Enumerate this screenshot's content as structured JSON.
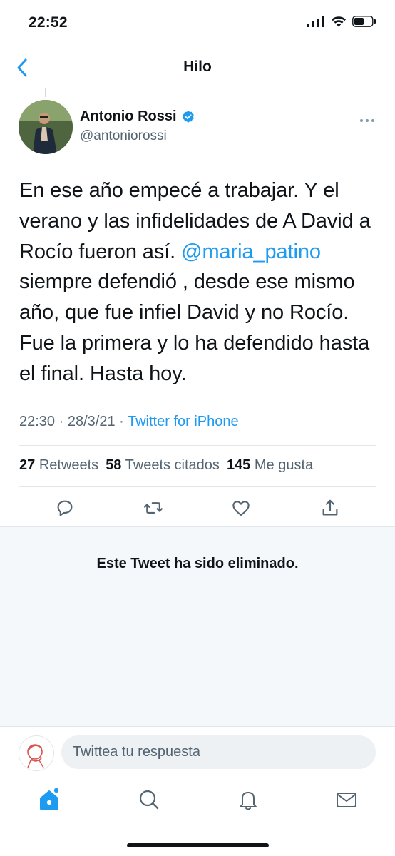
{
  "status_bar": {
    "time": "22:52"
  },
  "nav": {
    "title": "Hilo"
  },
  "tweet": {
    "author_name": "Antonio Rossi",
    "author_handle": "@antoniorossi",
    "text_before": "En ese año empecé a trabajar. Y el verano y las infidelidades de A David a Rocío fueron así. ",
    "mention": "@maria_patino",
    "text_after": " siempre defendió , desde ese mismo año, que fue infiel David y no Rocío. Fue la primera y lo ha defendido hasta el final. Hasta hoy.",
    "time": "22:30",
    "date": "28/3/21",
    "source": "Twitter for iPhone",
    "retweets_count": "27",
    "retweets_label": "Retweets",
    "quotes_count": "58",
    "quotes_label": "Tweets citados",
    "likes_count": "145",
    "likes_label": "Me gusta"
  },
  "deleted_notice": "Este Tweet ha sido eliminado.",
  "reply": {
    "placeholder": "Twittea tu respuesta"
  },
  "colors": {
    "accent": "#1d9bf0",
    "text": "#0f1419",
    "secondary": "#536471"
  },
  "icons": {
    "nav": "back-chevron-icon",
    "actions": [
      "reply-icon",
      "retweet-icon",
      "like-icon",
      "share-icon"
    ],
    "tabs": [
      "home-icon",
      "search-icon",
      "notifications-icon",
      "messages-icon"
    ]
  }
}
